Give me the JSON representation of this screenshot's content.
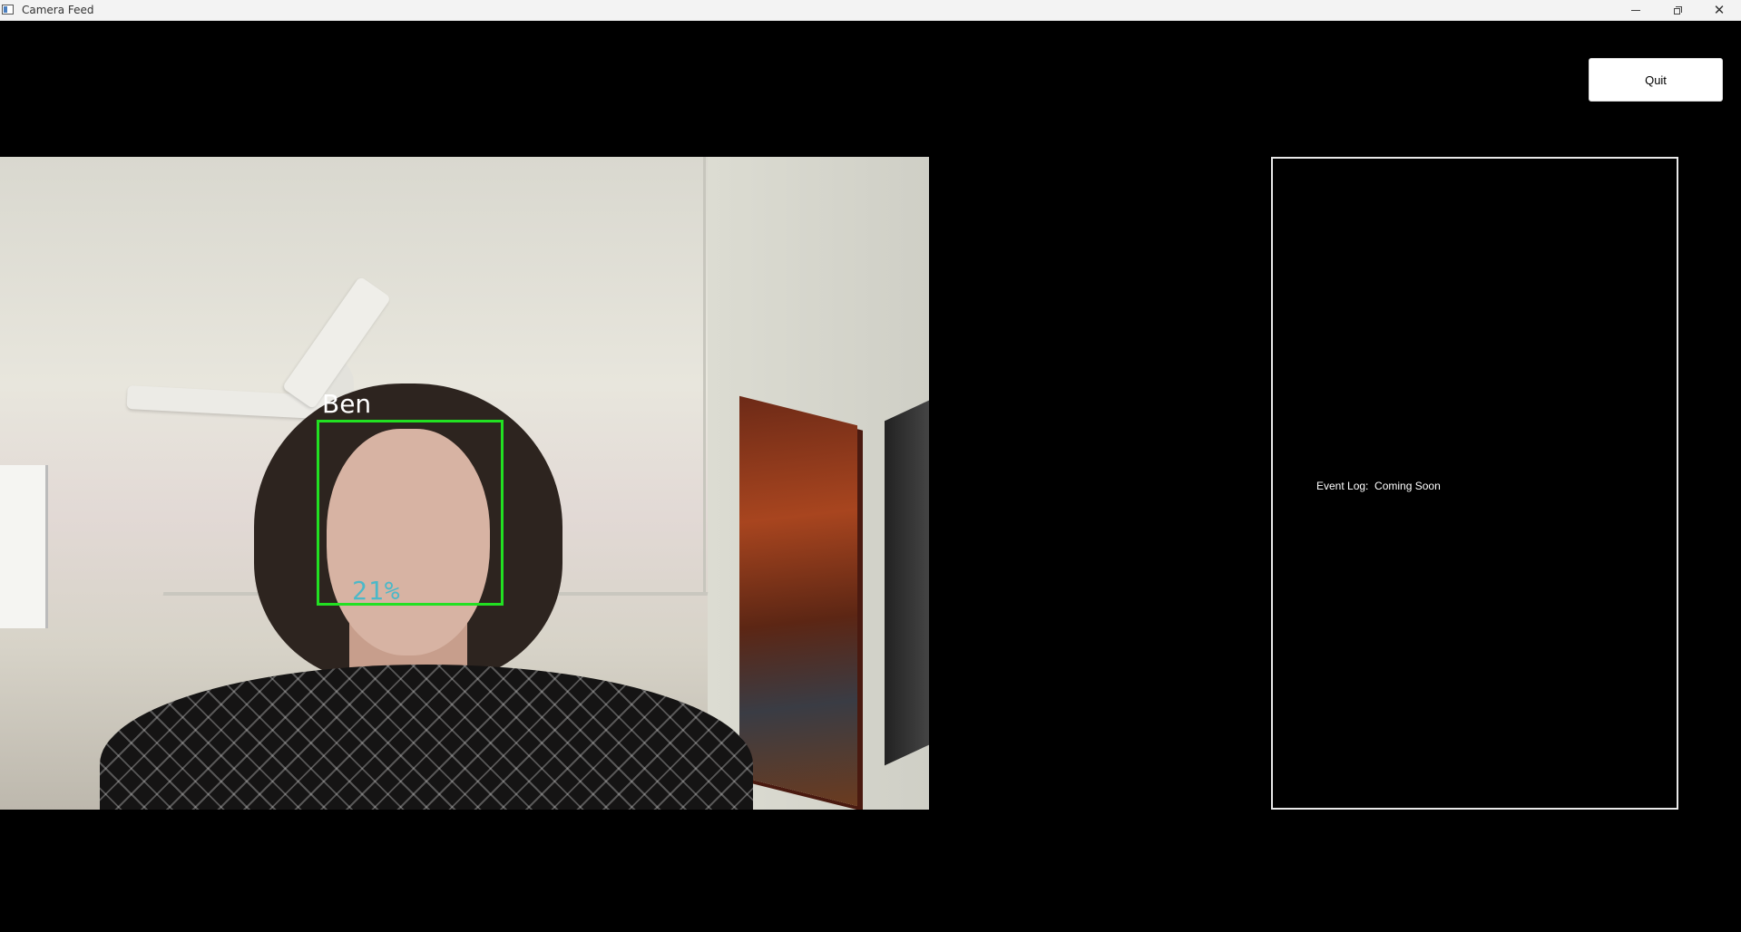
{
  "window": {
    "title": "Camera Feed",
    "close_glyph": "✕"
  },
  "toolbar": {
    "quit_label": "Quit"
  },
  "camera": {
    "detection": {
      "name": "Ben",
      "confidence": "21%"
    }
  },
  "event_log": {
    "text": "Event Log:  Coming Soon"
  },
  "colors": {
    "background": "#000000",
    "face_box": "#22e022",
    "confidence_text": "#4cb8c8"
  }
}
